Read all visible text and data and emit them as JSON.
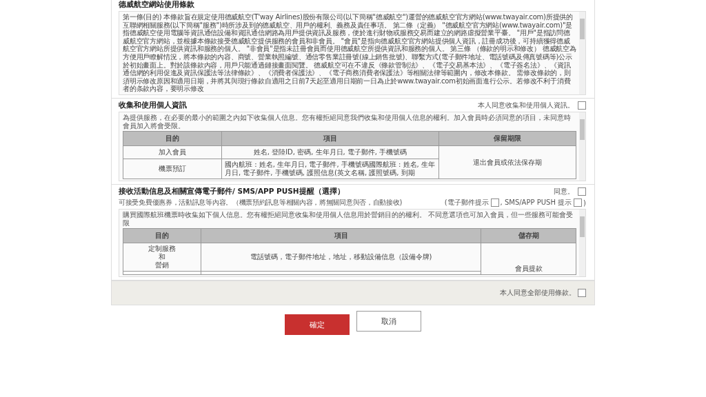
{
  "terms": {
    "title": "德威航空網站使用條款",
    "text": "第一條(目的) 本條款旨在規定使用德威航空(T'way Airlines)股份有限公司(以下簡稱\"德威航空\")運營的德威航空官方網站(www.twayair.com)所提供的互聯網相關服務(以下簡稱\"服務\")時所涉及到的德威航空、用戶的權利、義務及責任事項。 第二條（定義） \"德威航空官方網站(www.twayair.com)\"是指德威航空使用電腦等資訊通信設備和資訊通信網路為用戶提供資訊及服務，便於進行財物或服務交易而建立的網路虛擬營業平臺。 \"用戶\"是指訪問德威航空官方網站，並根據本條款接受德威航空提供服務的會員和非會員。 \"會員\"是指向德威航空官方網站提供個人資訊，註冊成功後，可持續獲得德威航空官方網站所提供資訊和服務的個人。 \"非會員\"是指未註冊會員而使用德威航空所提供資訊和服務的個人。 第三條 （條款的明示和修改） 德威航空為方便用戶瞭解情況，將本條款的內容、商號、營業執照編號、通信零售業註冊號(線上銷售批號)、聯繫方式(電子郵件地址、電話號碼及傳真號碼等)公示於初始畫面上。對於該條款內容，用戶只能通過鏈接畫面閱覽。 德威航空可在不違反《條款管制法》、《電子交易基本法》、《電子簽名法》、《資訊通信網的利用促進及資訊保護法等法律條款》、《消費者保護法》、《電子商務消費者保護法》等相關法律等範圍內，修改本條款。 需修改條款的，則須明示修改原因和適用日期，并將其與現行條款自適用之日前7天起至適用日期前一日為止於www.twayair.com初始画面進行公示。若修改不利于消費者的条款內容，要明示修改"
  },
  "personal": {
    "title": "收集和使用個人資訊",
    "agree_label": "本人同意收集和使用個人資訊。",
    "checked": false,
    "notice": "為提供服務，在必要的最小的範圍之內如下收集個人信息。您有權拒絕同意我們收集和使用個人信息的權利。加入會員時必須同意的項目，未同意時會員加入將會受限。",
    "columns": [
      "目的",
      "項目",
      "保留期限"
    ],
    "rows": [
      {
        "purpose": "加入會員",
        "items": "姓名, 登陸ID, 密碼, 生年月日, 電子郵件, 手機號碼"
      },
      {
        "purpose": "機票預訂",
        "items": "國內航班 : 姓名, 生年月日, 電子郵件, 手機號碼國際航班 : 姓名, 生年月日, 電子郵件, 手機號碼, 護照信息(英文名稱, 護照號碼, 到期"
      }
    ],
    "period": "退出會員或依法保存期"
  },
  "marketing": {
    "title": "接收活動信息及相關宣傳電子郵件/ SMS/APP PUSH提醒（選擇）",
    "agree_label": "同意。",
    "checked": false,
    "subtitle": "可接受免費優惠券，活動訊息等內容。（機票預約訊息等相關內容，將無關同意與否，自動接收)",
    "channels": [
      {
        "prefix": "(電子郵件提示",
        "checked": false
      },
      {
        "prefix": ", SMS/APP PUSH 提示",
        "label": ")",
        "checked": false
      }
    ],
    "notice": "購買國際航班機票時收集如下個人信息。您有權拒絕同意收集和使用個人信息用於營銷目的的權利。 不同意選項也可加入會員，但一些服務可能會受限",
    "columns": [
      "目的",
      "項目",
      "儲存期"
    ],
    "rows": [
      {
        "purpose": [
          "定制服務",
          "和",
          "營銷"
        ],
        "items": "電話號碼，電子郵件地址，地址，移動設備信息（設備令牌)"
      }
    ],
    "period": "會員提款"
  },
  "all_agree": {
    "label": "本人同意全部使用條款。",
    "checked": false
  },
  "buttons": [
    {
      "label": "確定",
      "kind": "primary"
    },
    {
      "label": "取消",
      "kind": "secondary"
    }
  ]
}
